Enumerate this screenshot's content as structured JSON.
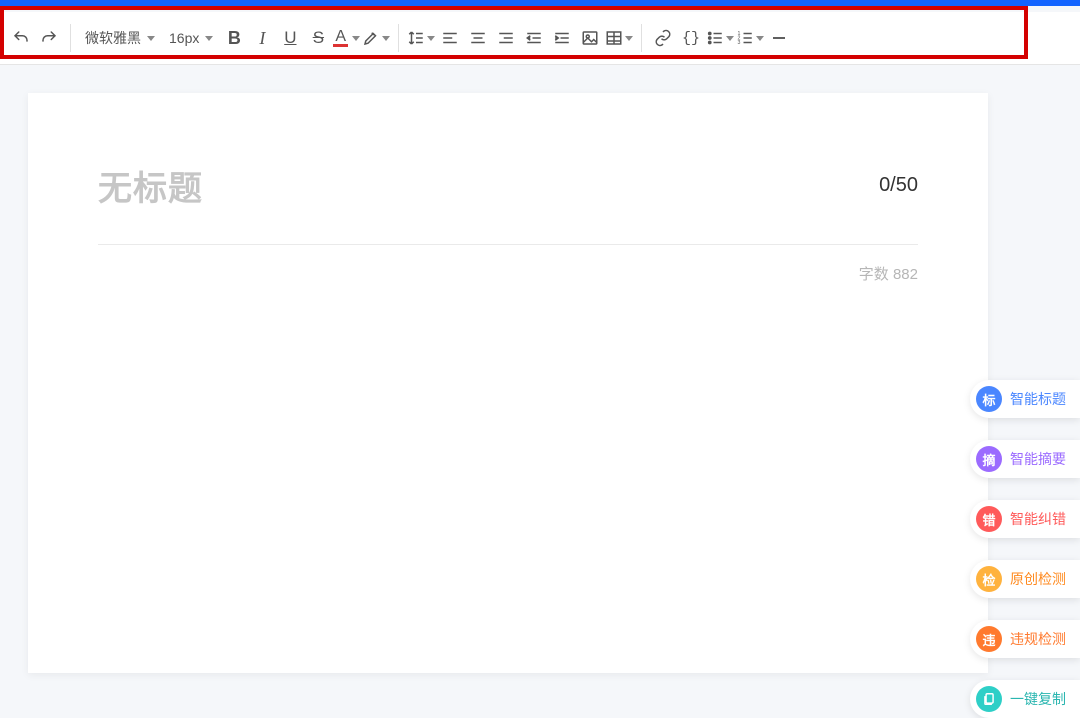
{
  "toolbar": {
    "font_family": "微软雅黑",
    "font_size": "16px",
    "icons": {
      "bold": "B",
      "italic": "I",
      "underline": "U",
      "strike": "S",
      "text_color": "A"
    }
  },
  "editor": {
    "title_placeholder": "无标题",
    "title_count": "0/50",
    "word_count_label": "字数 882"
  },
  "side": {
    "items": [
      {
        "badge": "标",
        "label": "智能标题",
        "color": "blue"
      },
      {
        "badge": "摘",
        "label": "智能摘要",
        "color": "purple"
      },
      {
        "badge": "错",
        "label": "智能纠错",
        "color": "red"
      },
      {
        "badge": "检",
        "label": "原创检测",
        "color": "yellow"
      },
      {
        "badge": "违",
        "label": "违规检测",
        "color": "orange"
      },
      {
        "badge": "",
        "label": "一键复制",
        "color": "teal"
      }
    ]
  }
}
